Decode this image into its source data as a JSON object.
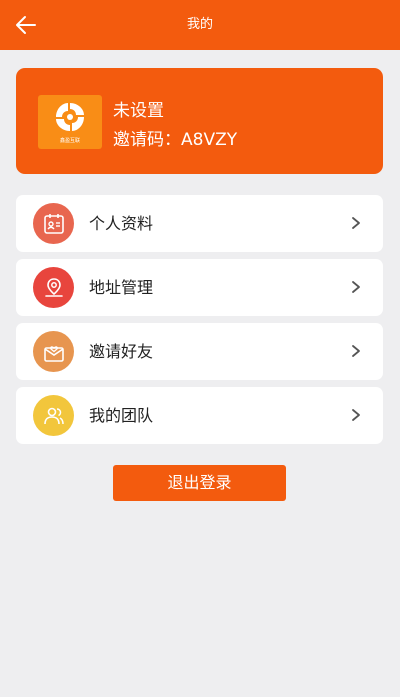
{
  "header": {
    "title": "我的",
    "back_icon": "arrow-left-icon",
    "background": "#f35b0e"
  },
  "profile": {
    "logo_icon": "brand-logo-icon",
    "logo_caption": "鑫盈互联",
    "name": "未设置",
    "invite_label": "邀请码：",
    "invite_code": "A8VZY"
  },
  "menu": [
    {
      "label": "个人资料",
      "icon": "id-card-icon",
      "color": "#e8664f"
    },
    {
      "label": "地址管理",
      "icon": "location-pin-icon",
      "color": "#e8453d"
    },
    {
      "label": "邀请好友",
      "icon": "envelope-heart-icon",
      "color": "#e7954f"
    },
    {
      "label": "我的团队",
      "icon": "team-icon",
      "color": "#f2c63c"
    }
  ],
  "logout_label": "退出登录",
  "colors": {
    "accent": "#f35b0e",
    "page_background": "#eeeef0",
    "card_background": "#ffffff"
  }
}
